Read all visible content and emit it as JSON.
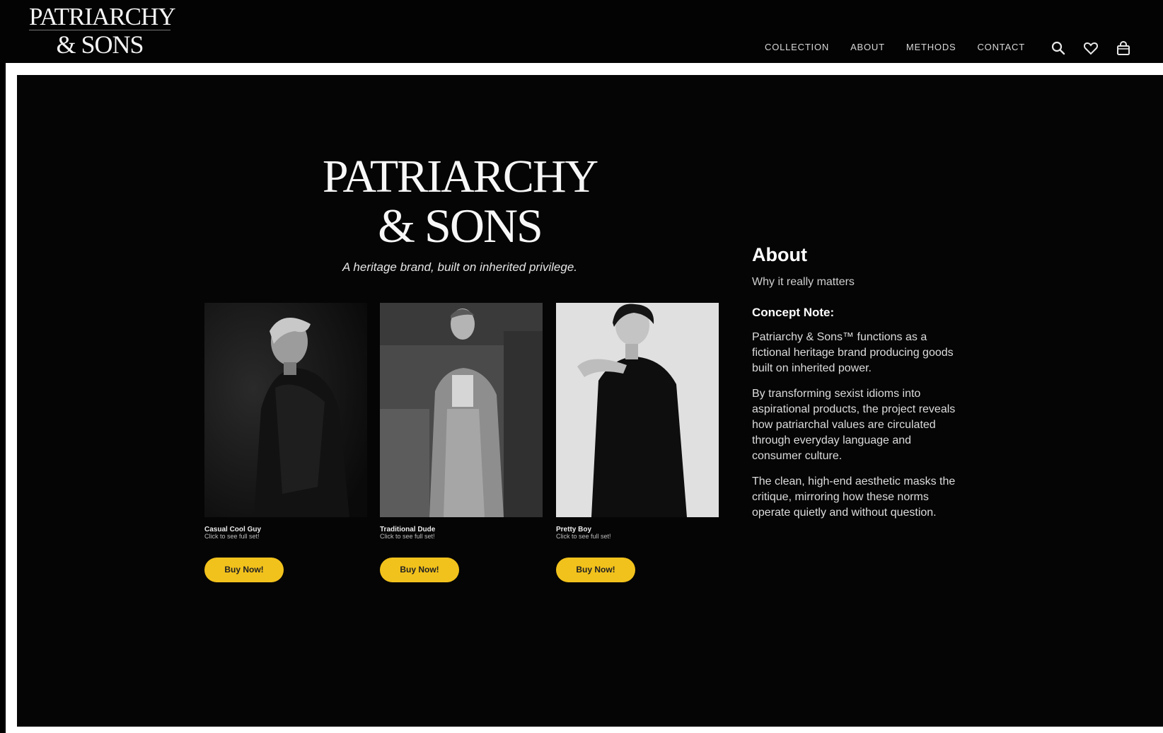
{
  "header": {
    "logo_line1": "PATRIARCHY",
    "logo_line2": "& SONS",
    "nav": [
      "COLLECTION",
      "ABOUT",
      "METHODS",
      "CONTACT"
    ],
    "icons": [
      "search-icon",
      "heart-icon",
      "shopping-bag-icon"
    ]
  },
  "hero": {
    "logo_line1": "PATRIARCHY",
    "logo_line2": "& SONS",
    "tagline": "A heritage brand, built on inherited privilege."
  },
  "products": [
    {
      "title": "Casual Cool Guy",
      "subtitle": "Click to see full set!",
      "button": "Buy Now!"
    },
    {
      "title": "Traditional Dude",
      "subtitle": "Click to see full set!",
      "button": "Buy Now!"
    },
    {
      "title": "Pretty Boy",
      "subtitle": "Click to see full set!",
      "button": "Buy Now!"
    }
  ],
  "about": {
    "heading": "About",
    "subheading": "Why it really matters",
    "concept_heading": "Concept Note:",
    "paragraphs": [
      "Patriarchy & Sons™ functions as a fictional heritage brand producing goods built on inherited power.",
      "By transforming sexist idioms into aspirational products, the project reveals how patriarchal values are circulated through everyday language and consumer culture.",
      "The clean, high-end aesthetic masks the critique, mirroring how these norms operate quietly and without question."
    ]
  },
  "colors": {
    "background": "#050505",
    "frame": "#ffffff",
    "button": "#f2c21c",
    "button_text": "#222222"
  }
}
